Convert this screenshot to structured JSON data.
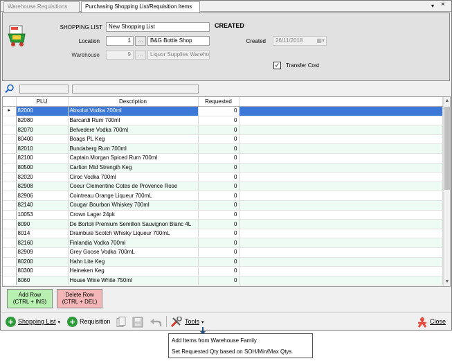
{
  "tabs": [
    {
      "label": "Warehouse Requisitions",
      "active": false
    },
    {
      "label": "Purchasing Shopping List/Requisition Items",
      "active": true
    }
  ],
  "tab_controls": {
    "dropdown": "▾",
    "close": "×"
  },
  "header": {
    "shopping_list_label": "SHOPPING LIST",
    "shopping_list_value": "New Shopping List",
    "status": "CREATED",
    "location_label": "Location",
    "location_id": "1",
    "location_name": "B&G Bottle Shop",
    "warehouse_label": "Warehouse",
    "warehouse_id": "9",
    "warehouse_name": "Liquor Supplies Wareho",
    "created_label": "Created",
    "created_value": "26/11/2018",
    "transfer_cost_label": "Transfer Cost",
    "transfer_cost_checked": true,
    "lookup_button": "..."
  },
  "grid": {
    "columns": [
      "PLU",
      "Description",
      "Requested"
    ],
    "rows": [
      {
        "plu": "82000",
        "desc": "Absolut Vodka 700ml",
        "req": "0"
      },
      {
        "plu": "82080",
        "desc": "Barcardi Rum 700ml",
        "req": "0"
      },
      {
        "plu": "82070",
        "desc": "Belvedere Vodka 700ml",
        "req": "0"
      },
      {
        "plu": "80400",
        "desc": "Boags PL Keg",
        "req": "0"
      },
      {
        "plu": "82010",
        "desc": "Bundaberg Rum 700ml",
        "req": "0"
      },
      {
        "plu": "82100",
        "desc": "Captain Morgan Spiced Rum 700ml",
        "req": "0"
      },
      {
        "plu": "80500",
        "desc": "Carlton Mid Strength Keg",
        "req": "0"
      },
      {
        "plu": "82020",
        "desc": "Ciroc Vodka 700ml",
        "req": "0"
      },
      {
        "plu": "82908",
        "desc": "Coeur Clementine Cotes de Provence Rose",
        "req": "0"
      },
      {
        "plu": "82906",
        "desc": "Cointreau Orange Liqueur 700mL",
        "req": "0"
      },
      {
        "plu": "82140",
        "desc": "Cougar Bourbon Whiskey 700ml",
        "req": "0"
      },
      {
        "plu": "10053",
        "desc": "Crown Lager 24pk",
        "req": "0"
      },
      {
        "plu": "8090",
        "desc": "De Bortoli Premium Semillon Sauvignon Blanc 4L",
        "req": "0"
      },
      {
        "plu": "8014",
        "desc": "Drambuie Scotch Whisky Liqueur 700mL",
        "req": "0"
      },
      {
        "plu": "82160",
        "desc": "Finlandia Vodka 700ml",
        "req": "0"
      },
      {
        "plu": "82909",
        "desc": "Grey Goose Vodka 700mL",
        "req": "0"
      },
      {
        "plu": "80200",
        "desc": "Hahn Lite Keg",
        "req": "0"
      },
      {
        "plu": "80300",
        "desc": "Heineken Keg",
        "req": "0"
      },
      {
        "plu": "8060",
        "desc": "House Wine White 750ml",
        "req": "0"
      }
    ]
  },
  "buttons": {
    "add_row": "Add Row\n(CTRL + INS)",
    "delete_row": "Delete Row\n(CTRL + DEL)"
  },
  "toolbar": {
    "shopping_list": "Shopping List",
    "requisition": "Requisition",
    "tools": "Tools",
    "close": "Close"
  },
  "tools_menu": [
    "Add Items from Warehouse Family",
    "Set Requested Qty based on SOH/Min/Max Qtys"
  ],
  "colors": {
    "selected_row": "#3c78d8",
    "alt_row": "#eefaf4",
    "add_button": "#b7f0b0",
    "delete_button": "#f4b6b6",
    "plus_circle": "#2e9b3a"
  }
}
